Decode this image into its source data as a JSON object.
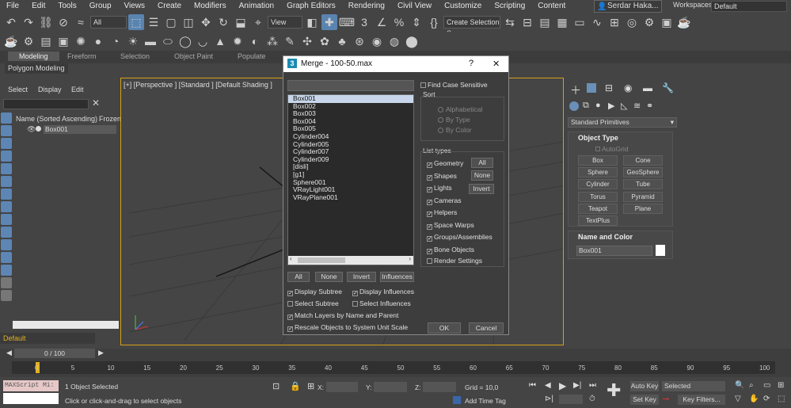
{
  "menu": {
    "items": [
      "File",
      "Edit",
      "Tools",
      "Group",
      "Views",
      "Create",
      "Modifiers",
      "Animation",
      "Graph Editors",
      "Rendering",
      "Civil View",
      "Customize",
      "Scripting",
      "Content"
    ],
    "user": "Serdar Haka...",
    "workspaces_label": "Workspaces:",
    "workspace_value": "Default"
  },
  "toolbar": {
    "filter_select": "All",
    "view_select": "View",
    "selection_set": "Create Selection Se"
  },
  "ribbon": {
    "tabs": [
      "Modeling",
      "Freeform",
      "Selection",
      "Object Paint",
      "Populate"
    ],
    "sub_label": "Polygon Modeling"
  },
  "scene_explorer": {
    "tabs": [
      "Select",
      "Display",
      "Edit"
    ],
    "column_name": "Name (Sorted Ascending)",
    "column_frozen": "Frozen",
    "item": "Box001",
    "layer": "Default"
  },
  "viewport": {
    "label": "[+] [Perspective ] [Standard ] [Default Shading ]"
  },
  "command_panel": {
    "dropdown": "Standard Primitives",
    "object_type_title": "Object Type",
    "autogrid": "AutoGrid",
    "primitives": [
      "Box",
      "Cone",
      "Sphere",
      "GeoSphere",
      "Cylinder",
      "Tube",
      "Torus",
      "Pyramid",
      "Teapot",
      "Plane",
      "TextPlus"
    ],
    "name_color_title": "Name and Color",
    "object_name": "Box001"
  },
  "dialog": {
    "title": "Merge - 100-50.max",
    "help": "?",
    "close": "✕",
    "objects": [
      "Box001",
      "Box002",
      "Box003",
      "Box004",
      "Box005",
      "Cylinder004",
      "Cylinder005",
      "Cylinder007",
      "Cylinder009",
      "[disli]",
      "[g1]",
      "Sphere001",
      "VRayLight001",
      "VRayPlane001"
    ],
    "selected_index": 0,
    "find_case_sensitive": "Find Case Sensitive",
    "sort_title": "Sort",
    "sort_options": [
      "Alphabetical",
      "By Type",
      "By Color"
    ],
    "list_types_title": "List types",
    "list_types": [
      "Geometry",
      "Shapes",
      "Lights",
      "Cameras",
      "Helpers",
      "Space Warps",
      "Groups/Assemblies",
      "Bone Objects"
    ],
    "render_settings": "Render Settings",
    "type_buttons": [
      "All",
      "None",
      "Invert"
    ],
    "list_buttons": [
      "All",
      "None",
      "Invert",
      "Influences"
    ],
    "options": [
      "Display Subtree",
      "Display Influences",
      "Select Subtree",
      "Select Influences",
      "Match Layers by Name and Parent",
      "Rescale Objects to System Unit Scale"
    ],
    "ok": "OK",
    "cancel": "Cancel"
  },
  "timeline": {
    "frame_counter": "0 / 100",
    "ticks": [
      "0",
      "5",
      "10",
      "15",
      "20",
      "25",
      "30",
      "35",
      "40",
      "45",
      "50",
      "55",
      "60",
      "65",
      "70",
      "75",
      "80",
      "85",
      "90",
      "95",
      "100"
    ]
  },
  "status": {
    "maxscript": "MAXScript Mi:",
    "selected": "1 Object Selected",
    "hint": "Click or click-and-drag to select objects",
    "x_label": "X:",
    "y_label": "Y:",
    "z_label": "Z:",
    "grid": "Grid = 10,0",
    "add_time_tag": "Add Time Tag",
    "auto_key": "Auto Key",
    "set_key": "Set Key",
    "selected_dropdown": "Selected",
    "key_filters": "Key Filters..."
  }
}
